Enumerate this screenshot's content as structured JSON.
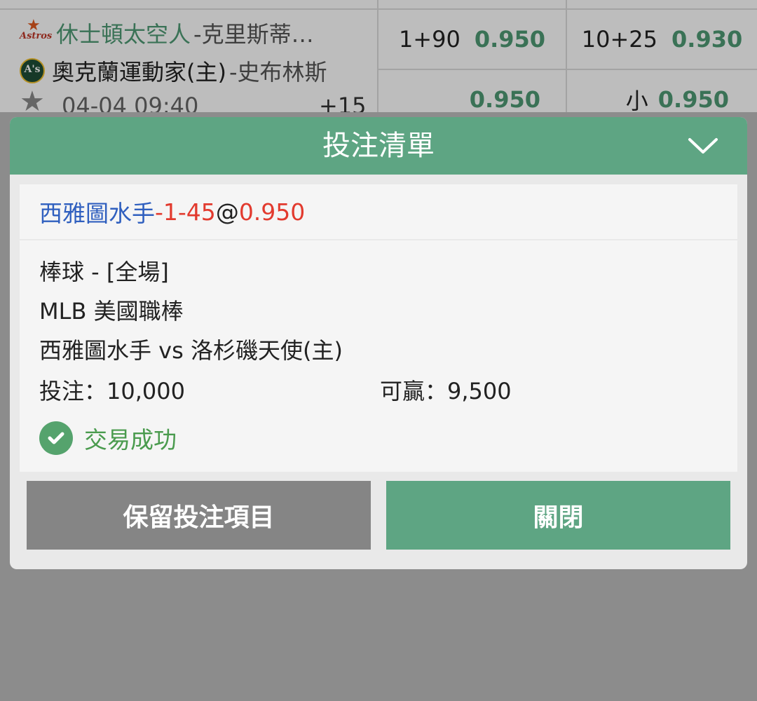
{
  "match_list": {
    "row1": {
      "away_team": "休士頓太空人",
      "away_pitcher": "-克里斯蒂…",
      "home_team": "奧克蘭運動家(主)",
      "home_pitcher": "-史布林斯",
      "away_logo_text": "Astros",
      "home_logo_text": "A's",
      "handicap_line": "1+90",
      "handicap_odds": "0.950",
      "total_line": "10+25",
      "total_odds": "0.930",
      "handicap_odds_2": "0.950",
      "total_under_label": "小",
      "total_under_odds": "0.950"
    },
    "row2": {
      "datetime": "04-04 09:40",
      "handicap_partial": "+15"
    }
  },
  "bet_slip": {
    "title": "投注清單",
    "selection": {
      "team": "西雅圖水手",
      "handicap": "-1-45",
      "at": "@",
      "odds": "0.950"
    },
    "sport_line": "棒球 - [全場]",
    "league": "MLB 美國職棒",
    "matchup": "西雅圖水手 vs 洛杉磯天使(主)",
    "stake_label": "投注：10,000",
    "win_label": "可贏：9,500",
    "status": "交易成功",
    "keep_button": "保留投注項目",
    "close_button": "關閉"
  },
  "colors": {
    "header_green": "#5ea583",
    "odds_green": "#4f9a74",
    "team_blue": "#2f5fbf",
    "handicap_red": "#e23a2e",
    "keep_gray": "#858585",
    "success_green": "#55a36d"
  },
  "icons": [
    "astros-logo",
    "athletics-logo",
    "favorite-star-icon",
    "chevron-down-icon",
    "check-circle-icon"
  ]
}
